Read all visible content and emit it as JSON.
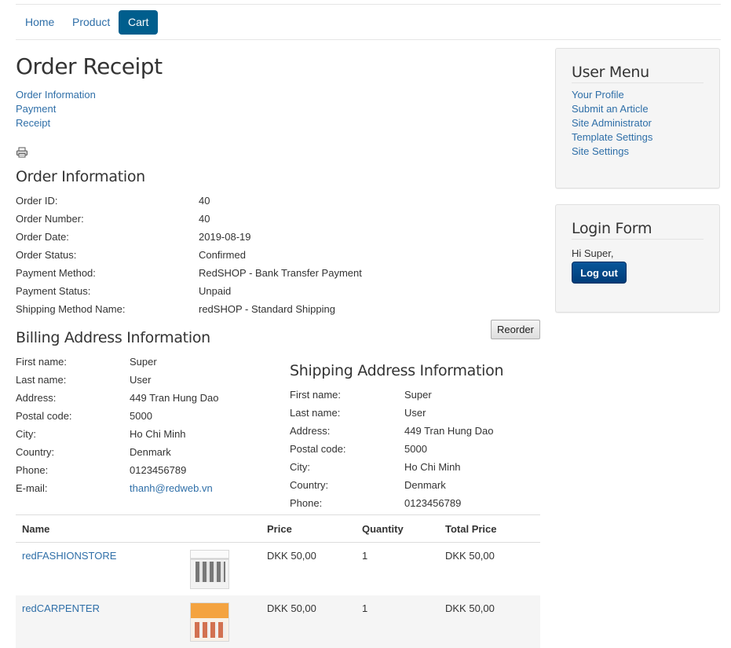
{
  "nav": {
    "items": [
      "Home",
      "Product",
      "Cart"
    ],
    "active": "Cart"
  },
  "page": {
    "title": "Order Receipt",
    "steps": [
      "Order Information",
      "Payment",
      "Receipt"
    ]
  },
  "icons": {
    "print": "printer-icon"
  },
  "order_info": {
    "title": "Order Information",
    "rows": [
      {
        "label": "Order ID:",
        "value": "40"
      },
      {
        "label": "Order Number:",
        "value": "40"
      },
      {
        "label": "Order Date:",
        "value": "2019-08-19"
      },
      {
        "label": "Order Status:",
        "value": "Confirmed"
      },
      {
        "label": "Payment Method:",
        "value": "RedSHOP - Bank Transfer Payment"
      },
      {
        "label": "Payment Status:",
        "value": "Unpaid"
      },
      {
        "label": "Shipping Method Name:",
        "value": "redSHOP - Standard Shipping"
      }
    ]
  },
  "reorder_label": "Reorder",
  "billing": {
    "title": "Billing Address Information",
    "rows": [
      {
        "label": "First name:",
        "value": "Super"
      },
      {
        "label": "Last name:",
        "value": "User"
      },
      {
        "label": "Address:",
        "value": "449 Tran Hung Dao"
      },
      {
        "label": "Postal code:",
        "value": "5000"
      },
      {
        "label": "City:",
        "value": "Ho Chi Minh"
      },
      {
        "label": "Country:",
        "value": "Denmark"
      },
      {
        "label": "Phone:",
        "value": "0123456789"
      },
      {
        "label": "E-mail:",
        "value": "thanh@redweb.vn"
      }
    ]
  },
  "shipping": {
    "title": "Shipping Address Information",
    "rows": [
      {
        "label": "First name:",
        "value": "Super"
      },
      {
        "label": "Last name:",
        "value": "User"
      },
      {
        "label": "Address:",
        "value": "449 Tran Hung Dao"
      },
      {
        "label": "Postal code:",
        "value": "5000"
      },
      {
        "label": "City:",
        "value": "Ho Chi Minh"
      },
      {
        "label": "Country:",
        "value": "Denmark"
      },
      {
        "label": "Phone:",
        "value": "0123456789"
      }
    ]
  },
  "cart": {
    "headers": {
      "name": "Name",
      "price": "Price",
      "quantity": "Quantity",
      "total": "Total Price"
    },
    "items": [
      {
        "name": "redFASHIONSTORE",
        "price": "DKK 50,00",
        "quantity": "1",
        "total": "DKK 50,00"
      },
      {
        "name": "redCARPENTER",
        "price": "DKK 50,00",
        "quantity": "1",
        "total": "DKK 50,00"
      }
    ]
  },
  "user_menu": {
    "title": "User Menu",
    "links": [
      "Your Profile",
      "Submit an Article",
      "Site Administrator",
      "Template Settings",
      "Site Settings"
    ]
  },
  "login": {
    "title": "Login Form",
    "greeting": "Hi Super,",
    "logout_label": "Log out"
  },
  "colors": {
    "link": "#2f6fa8",
    "nav_active_bg": "#005e8d",
    "logout_bg": "#08569a",
    "sidebar_bg": "#f5f5f5"
  }
}
